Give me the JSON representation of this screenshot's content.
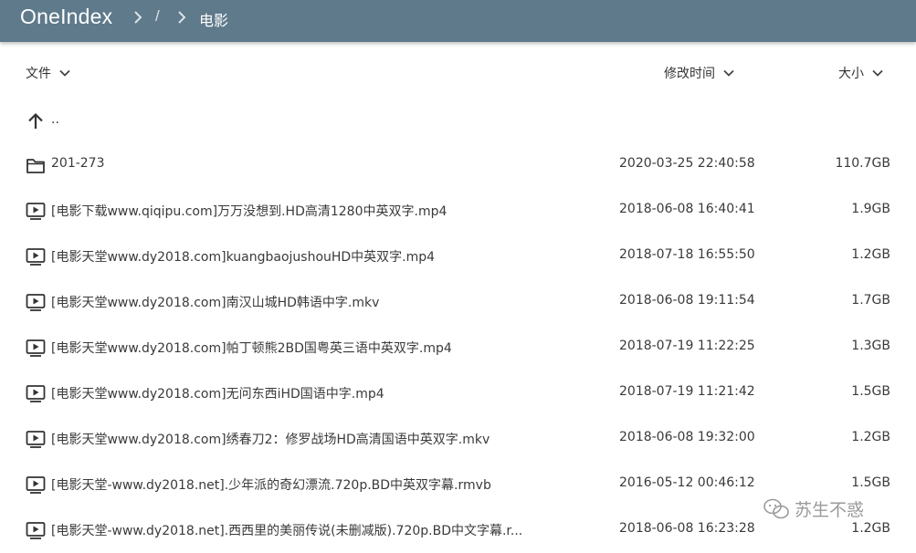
{
  "app": {
    "brand": "OneIndex",
    "breadcrumb_root": "/",
    "breadcrumb_current": "电影"
  },
  "columns": {
    "name": "文件",
    "modified": "修改时间",
    "size": "大小"
  },
  "parent_link": "..",
  "files": [
    {
      "type": "folder",
      "name": "201-273",
      "date": "2020-03-25 22:40:58",
      "size": "110.7GB"
    },
    {
      "type": "video",
      "name": "[电影下载www.qiqipu.com]万万没想到.HD高清1280中英双字.mp4",
      "date": "2018-06-08 16:40:41",
      "size": "1.9GB"
    },
    {
      "type": "video",
      "name": "[电影天堂www.dy2018.com]kuangbaojushouHD中英双字.mp4",
      "date": "2018-07-18 16:55:50",
      "size": "1.2GB"
    },
    {
      "type": "video",
      "name": "[电影天堂www.dy2018.com]南汉山城HD韩语中字.mkv",
      "date": "2018-06-08 19:11:54",
      "size": "1.7GB"
    },
    {
      "type": "video",
      "name": "[电影天堂www.dy2018.com]帕丁顿熊2BD国粤英三语中英双字.mp4",
      "date": "2018-07-19 11:22:25",
      "size": "1.3GB"
    },
    {
      "type": "video",
      "name": "[电影天堂www.dy2018.com]无问东西iHD国语中字.mp4",
      "date": "2018-07-19 11:21:42",
      "size": "1.5GB"
    },
    {
      "type": "video",
      "name": "[电影天堂www.dy2018.com]绣春刀2：修罗战场HD高清国语中英双字.mkv",
      "date": "2018-06-08 19:32:00",
      "size": "1.2GB"
    },
    {
      "type": "video",
      "name": "[电影天堂-www.dy2018.net].少年派的奇幻漂流.720p.BD中英双字幕.rmvb",
      "date": "2016-05-12 00:46:12",
      "size": "1.5GB"
    },
    {
      "type": "video",
      "name": "[电影天堂-www.dy2018.net].西西里的美丽传说(未删减版).720p.BD中文字幕.r...",
      "date": "2018-06-08 16:23:28",
      "size": "1.2GB"
    }
  ],
  "watermark": "苏生不惑",
  "colors": {
    "topbar": "#5e7a8b",
    "text": "#333333"
  }
}
